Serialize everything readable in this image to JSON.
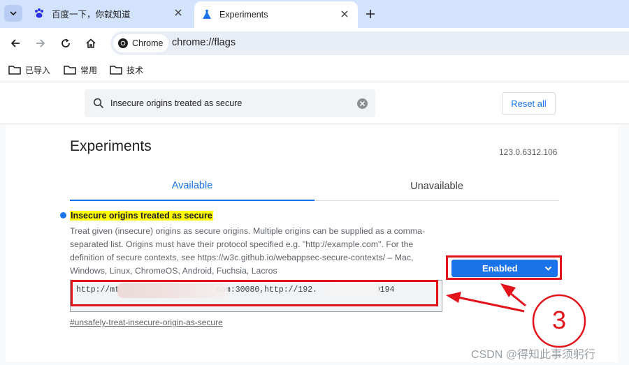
{
  "browser": {
    "tabs": [
      {
        "title": "百度一下，你就知道",
        "favicon": "baidu-paw-icon"
      },
      {
        "title": "Experiments",
        "favicon": "flask-icon",
        "active": true
      }
    ],
    "omnibox": {
      "chip_label": "Chrome",
      "url": "chrome://flags"
    },
    "bookmarks": [
      "已导入",
      "常用",
      "技术"
    ]
  },
  "flags": {
    "search_value": "Insecure origins treated as secure",
    "reset_label": "Reset all",
    "title": "Experiments",
    "version": "123.0.6312.106",
    "tabs": [
      "Available",
      "Unavailable"
    ],
    "flag": {
      "name": "Insecure origins treated as secure",
      "description": "Treat given (insecure) origins as secure origins. Multiple origins can be supplied as a comma-separated list. Origins must have their protocol specified e.g. \"http://example.com\". For the definition of secure contexts, see https://w3c.github.io/webappsec-secure-contexts/ – Mac, Windows, Linux, ChromeOS, Android, Fuchsia, Lacros",
      "textarea_value": "http://mt                    com:30080,http://192.            9194",
      "link": "#unsafely-treat-insecure-origin-as-secure",
      "state": "Enabled"
    }
  },
  "annotation": {
    "step": "3",
    "color": "#e2131a"
  },
  "watermark": "CSDN @得知此事须躬行",
  "colors": {
    "accent": "#1a73e8",
    "highlight": "#ffff00",
    "tabstrip": "#d3e3fd"
  }
}
